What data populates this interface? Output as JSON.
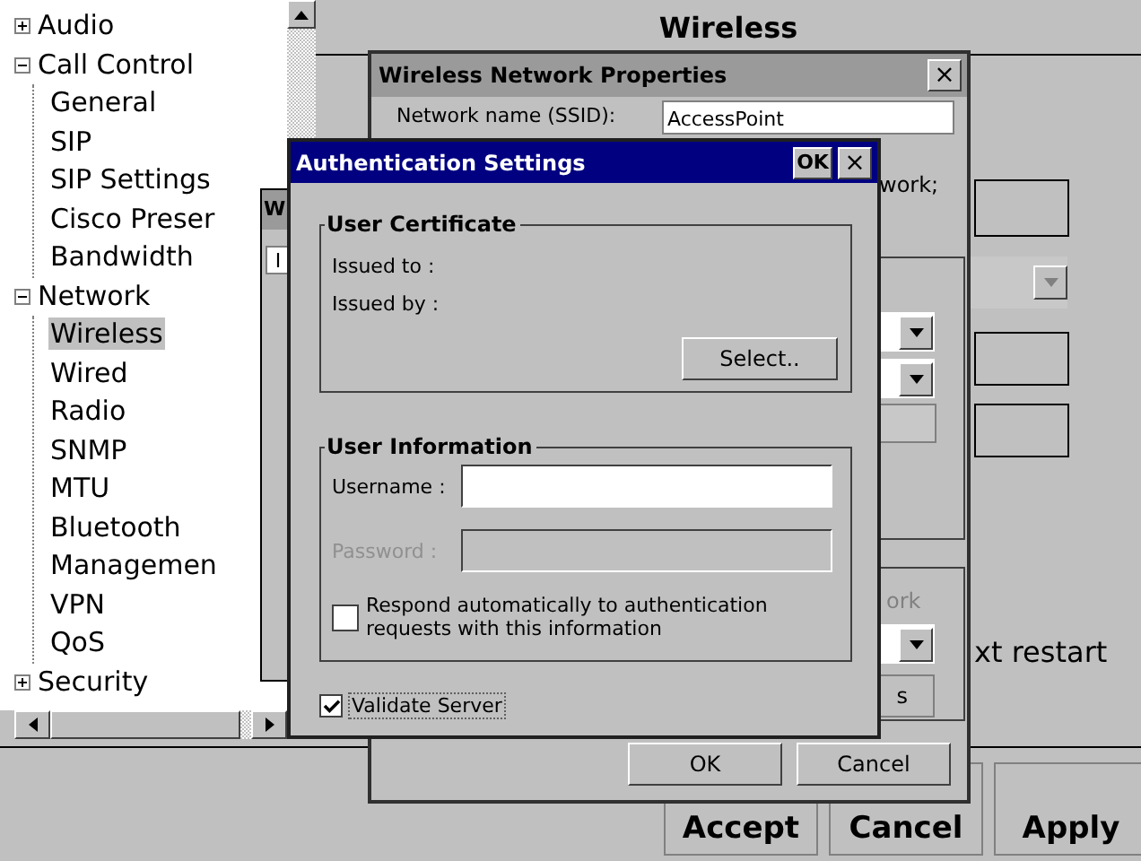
{
  "tree": {
    "items": [
      {
        "label": "Audio",
        "expanded": false,
        "selected": false
      },
      {
        "label": "Call Control",
        "expanded": true,
        "selected": false,
        "children": [
          {
            "label": "General",
            "selected": false
          },
          {
            "label": "SIP",
            "selected": false
          },
          {
            "label": "SIP Settings",
            "selected": false
          },
          {
            "label": "Cisco Preser",
            "selected": false
          },
          {
            "label": "Bandwidth",
            "selected": false
          }
        ]
      },
      {
        "label": "Network",
        "expanded": true,
        "selected": false,
        "children": [
          {
            "label": "Wireless",
            "selected": true
          },
          {
            "label": "Wired",
            "selected": false
          },
          {
            "label": "Radio",
            "selected": false
          },
          {
            "label": "SNMP",
            "selected": false
          },
          {
            "label": "MTU",
            "selected": false
          },
          {
            "label": "Bluetooth",
            "selected": false
          },
          {
            "label": "Managemen",
            "selected": false
          },
          {
            "label": "VPN",
            "selected": false
          },
          {
            "label": "QoS",
            "selected": false
          }
        ]
      },
      {
        "label": "Security",
        "expanded": false,
        "selected": false
      }
    ]
  },
  "main": {
    "title": "Wireless",
    "partial_text": "xt restart",
    "buttons": [
      "Accept",
      "Cancel",
      "Apply"
    ]
  },
  "background_window": {
    "title": "W",
    "tab": "I"
  },
  "properties_window": {
    "title": "Wireless Network Properties",
    "close": "×",
    "ssid_label": "Network name (SSID):",
    "ssid_value": "AccessPoint",
    "partial_text": "work;",
    "group_label": "ork",
    "button_text": "s",
    "buttons": [
      "OK",
      "Cancel"
    ]
  },
  "auth_dialog": {
    "title": "Authentication Settings",
    "ok": "OK",
    "close": "×",
    "certificate": {
      "label": "User Certificate",
      "issued_to": "Issued to :",
      "issued_by": "Issued by :",
      "select": "Select.."
    },
    "user_info": {
      "label": "User Information",
      "username_label": "Username :",
      "password_label": "Password :",
      "password_disabled": true,
      "respond": {
        "text": "Respond automatically to authentication requests with this information",
        "checked": false
      }
    },
    "validate": {
      "text": "Validate Server",
      "checked": true
    }
  }
}
